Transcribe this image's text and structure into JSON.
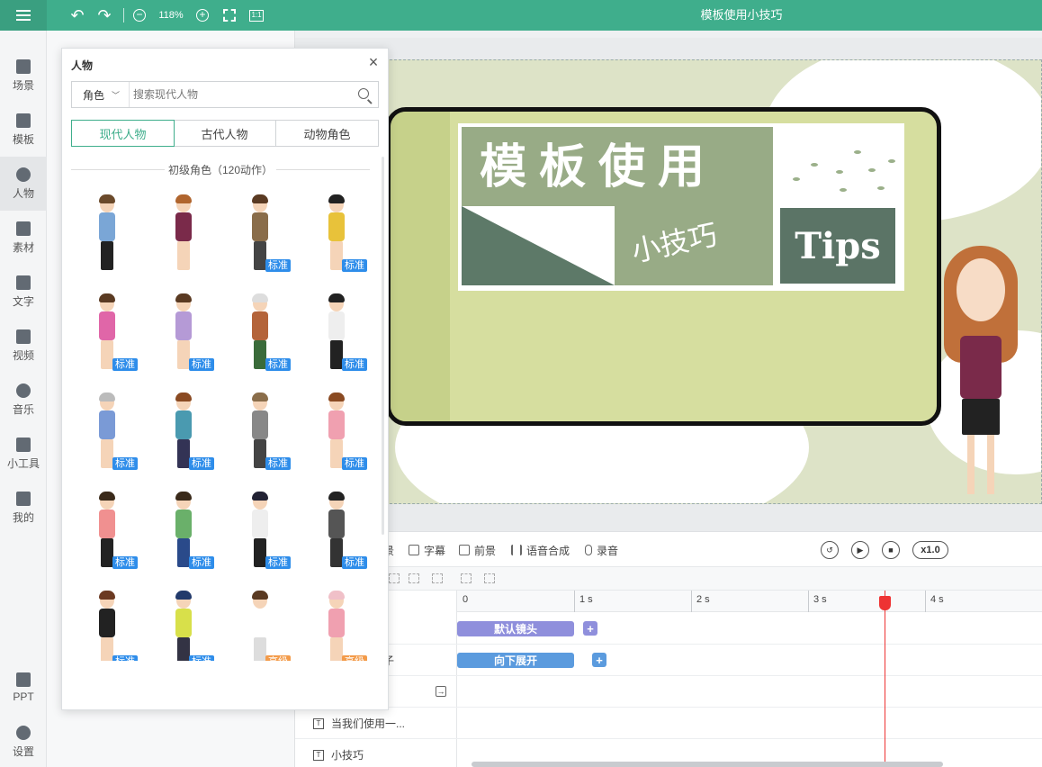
{
  "topbar": {
    "title": "模板使用小技巧",
    "zoom": "118%"
  },
  "sidebar": {
    "items": [
      {
        "label": "场景",
        "icon": "scene-icon"
      },
      {
        "label": "模板",
        "icon": "template-icon"
      },
      {
        "label": "人物",
        "icon": "person-icon"
      },
      {
        "label": "素材",
        "icon": "material-icon"
      },
      {
        "label": "文字",
        "icon": "text-icon"
      },
      {
        "label": "视频",
        "icon": "video-icon"
      },
      {
        "label": "音乐",
        "icon": "music-icon"
      },
      {
        "label": "小工具",
        "icon": "toolbox-icon"
      },
      {
        "label": "我的",
        "icon": "upload-icon"
      },
      {
        "label": "PPT",
        "icon": "ppt-icon"
      },
      {
        "label": "设置",
        "icon": "gear-icon"
      }
    ]
  },
  "stage": {
    "label": "头",
    "banner_big": "模板使用",
    "banner_small": "小技巧",
    "banner_tips": "Tips"
  },
  "toolbar": {
    "cut_label": "景",
    "subtitle_label": "字幕",
    "foreground_label": "前景",
    "tts_label": "语音合成",
    "record_label": "录音",
    "speed": "x1.0"
  },
  "ruler": {
    "ticks": [
      "0",
      "1 s",
      "2 s",
      "3 s",
      "4 s"
    ]
  },
  "timeline": {
    "rows": [
      {
        "label": "",
        "clip": "默认镜头"
      },
      {
        "label": "子",
        "clip": "向下展开"
      },
      {
        "label": "",
        "clip": ""
      },
      {
        "label": "当我们使用一...",
        "clip": ""
      },
      {
        "label": "小技巧",
        "clip": ""
      }
    ]
  },
  "popup": {
    "title": "人物",
    "select_value": "角色",
    "search_placeholder": "搜索现代人物",
    "tabs": [
      "现代人物",
      "古代人物",
      "动物角色"
    ],
    "section": "初级角色（120动作）",
    "characters": [
      {
        "badge": ""
      },
      {
        "badge": ""
      },
      {
        "badge": "标准"
      },
      {
        "badge": "标准"
      },
      {
        "badge": "标准"
      },
      {
        "badge": "标准"
      },
      {
        "badge": "标准"
      },
      {
        "badge": "标准"
      },
      {
        "badge": "标准"
      },
      {
        "badge": "标准"
      },
      {
        "badge": "标准"
      },
      {
        "badge": "标准"
      },
      {
        "badge": "标准"
      },
      {
        "badge": "标准"
      },
      {
        "badge": "标准"
      },
      {
        "badge": "标准"
      },
      {
        "badge": "标准"
      },
      {
        "badge": "标准"
      },
      {
        "badge": "高级"
      },
      {
        "badge": "高级"
      }
    ]
  },
  "colors": {
    "brand": "#3fae8c",
    "badge_standard": "#2e8dea",
    "badge_advanced": "#f39b4a",
    "clip_camera": "#8f8fdc",
    "clip_effect": "#5b9bde"
  }
}
